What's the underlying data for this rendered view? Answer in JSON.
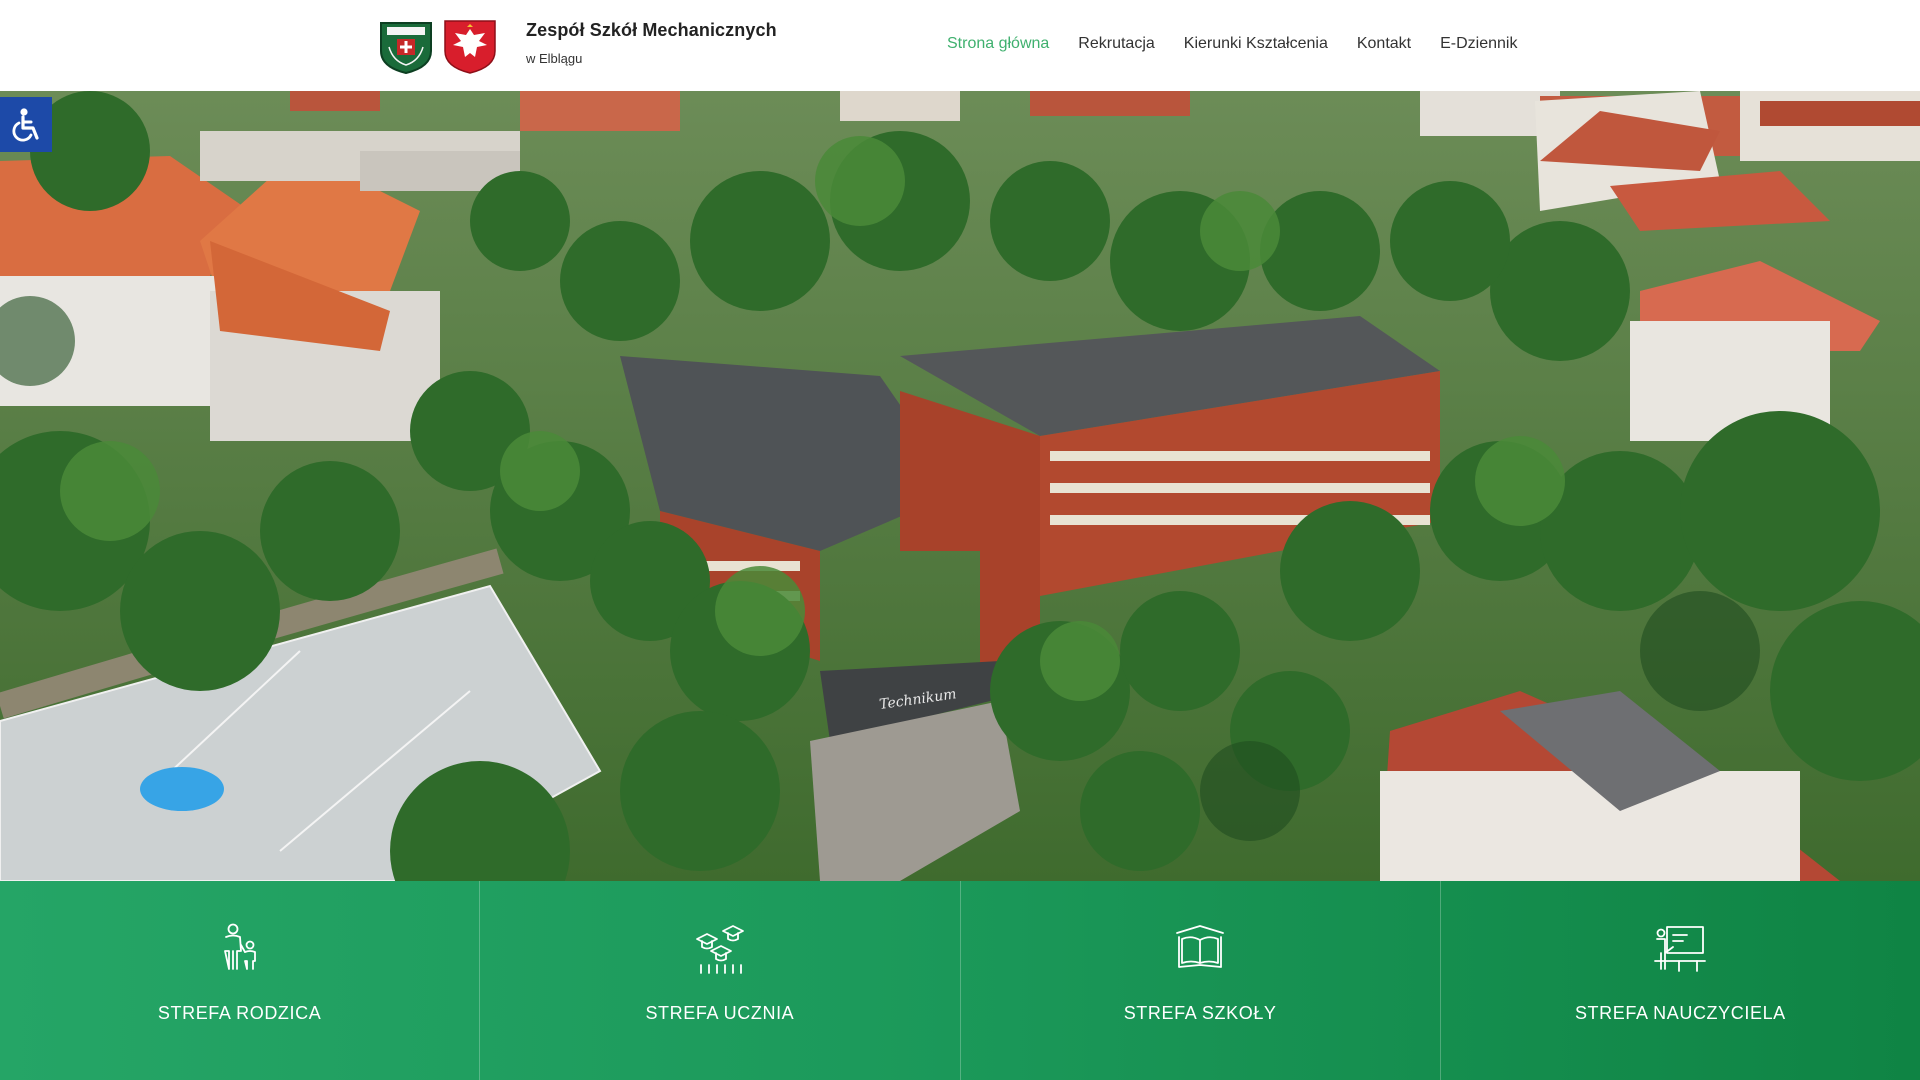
{
  "header": {
    "school_name": "Zespół Szkół Mechanicznych",
    "school_location": "w Elblągu",
    "logos": [
      "school-crest-logo",
      "polish-eagle-emblem"
    ]
  },
  "nav": {
    "items": [
      {
        "label": "Strona główna",
        "active": true
      },
      {
        "label": "Rekrutacja",
        "active": false
      },
      {
        "label": "Kierunki Kształcenia",
        "active": false
      },
      {
        "label": "Kontakt",
        "active": false
      },
      {
        "label": "E-Dziennik",
        "active": false
      }
    ],
    "active_color": "#3fb06e"
  },
  "accessibility": {
    "icon": "wheelchair-icon",
    "color": "#1d4aa8"
  },
  "hero": {
    "description_icon": "aerial-campus-photo",
    "sign_text": "Technikum"
  },
  "zones": {
    "items": [
      {
        "label": "STREFA RODZICA",
        "icon": "parent-child-icon"
      },
      {
        "label": "STREFA UCZNIA",
        "icon": "graduation-caps-icon"
      },
      {
        "label": "STREFA SZKOŁY",
        "icon": "open-book-icon"
      },
      {
        "label": "STREFA NAUCZYCIELA",
        "icon": "teacher-board-icon"
      }
    ],
    "gradient_start": "#25a566",
    "gradient_end": "#0f8444"
  }
}
